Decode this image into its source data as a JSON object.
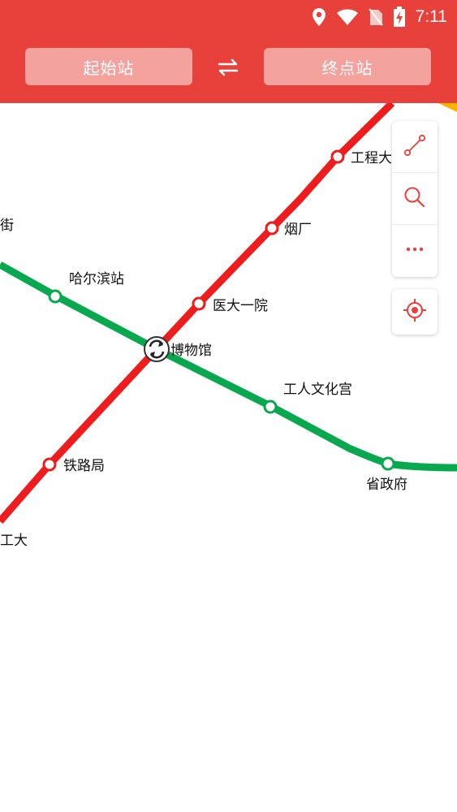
{
  "status_bar": {
    "time": "7:11",
    "icons": [
      "location-icon",
      "wifi-icon",
      "no-sim-icon",
      "battery-charging-icon"
    ]
  },
  "route_bar": {
    "start_placeholder": "起始站",
    "end_placeholder": "终点站",
    "swap_icon": "swap-icon"
  },
  "map": {
    "lines": [
      {
        "color": "#ee1c1c",
        "name": ""
      },
      {
        "color": "#07a84e",
        "name": ""
      }
    ],
    "stations": {
      "gongchengda": "工程大",
      "dajie": "大街",
      "yanchang": "烟厂",
      "harbin_zhan": "哈尔滨站",
      "yida_yiyuan": "医大一院",
      "bowuguan": "博物馆",
      "gongren_wenhuagong": "工人文化宫",
      "tieluju": "铁路局",
      "shengzhengfu": "省政府",
      "hagongda": "哈工大"
    },
    "transfer_icon": "transfer-icon"
  },
  "tools": {
    "items": [
      {
        "name": "route-icon"
      },
      {
        "name": "search-icon"
      },
      {
        "name": "more-icon"
      }
    ],
    "locate": "locate-icon"
  },
  "colors": {
    "primary": "#e8403a",
    "button_fill": "#f4a29e",
    "red_line": "#ee1c1c",
    "green_line": "#07a84e"
  }
}
